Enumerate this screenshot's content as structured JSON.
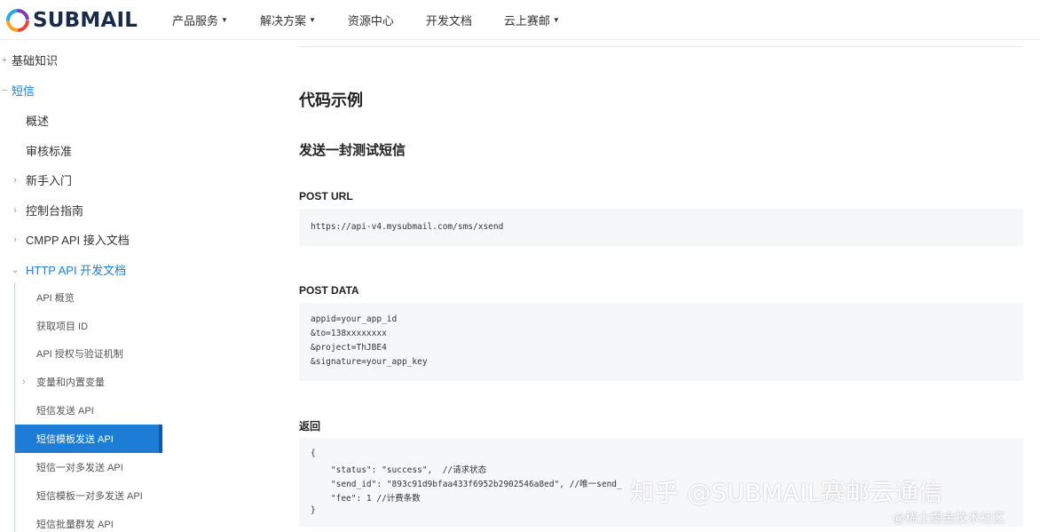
{
  "brand": {
    "name": "SUBMAIL"
  },
  "nav": {
    "items": [
      {
        "label": "产品服务",
        "dropdown": true
      },
      {
        "label": "解决方案",
        "dropdown": true
      },
      {
        "label": "资源中心",
        "dropdown": false
      },
      {
        "label": "开发文档",
        "dropdown": false
      },
      {
        "label": "云上赛邮",
        "dropdown": true
      }
    ]
  },
  "sidebar": {
    "top": [
      {
        "label": "基础知识",
        "expander": "+"
      },
      {
        "label": "短信",
        "expander": "−"
      }
    ],
    "level2": [
      {
        "label": "概述"
      },
      {
        "label": "审核标准"
      },
      {
        "label": "新手入门",
        "expander": "›"
      },
      {
        "label": "控制台指南",
        "expander": "›"
      },
      {
        "label": "CMPP API 接入文档",
        "expander": "›"
      },
      {
        "label": "HTTP API 开发文档",
        "expander": "⌄"
      }
    ],
    "level3": [
      {
        "label": "API 概览"
      },
      {
        "label": "获取项目 ID"
      },
      {
        "label": "API 授权与验证机制"
      },
      {
        "label": "变量和内置变量",
        "expander": "›"
      },
      {
        "label": "短信发送 API"
      },
      {
        "label": "短信模板发送 API",
        "active": true
      },
      {
        "label": "短信一对多发送 API"
      },
      {
        "label": "短信模板一对多发送 API"
      },
      {
        "label": "短信批量群发 API"
      }
    ]
  },
  "content": {
    "title": "代码示例",
    "subtitle": "发送一封测试短信",
    "post_url_label": "POST URL",
    "post_url": "https://api-v4.mysubmail.com/sms/xsend",
    "post_data_label": "POST DATA",
    "post_data_lines": [
      "appid=your_app_id",
      "&to=138xxxxxxxx",
      "&project=ThJBE4",
      "&signature=your_app_key"
    ],
    "return_label": "返回",
    "return_lines": [
      "{",
      "    \"status\": \"success\",  //请求状态",
      "    \"send_id\": \"893c91d9bfaa433f6952b2902546a8ed\", //唯一send_",
      "    \"fee\": 1 //计费条数",
      "}"
    ]
  },
  "watermark": {
    "main": "知乎 @SUBMAIL赛邮云通信",
    "sub": "@稀土掘金技术社区"
  },
  "colors": {
    "accent": "#1d7dd6",
    "code_bg": "#f6f7f9"
  }
}
